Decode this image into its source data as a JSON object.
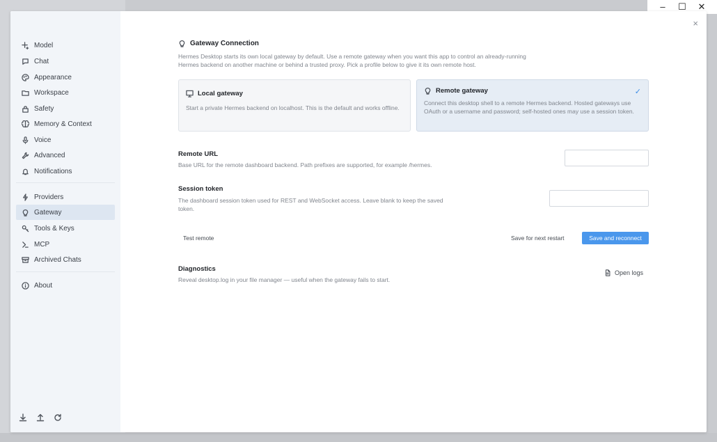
{
  "window": {
    "minimize": "–",
    "maximize": "☐",
    "close": "✕"
  },
  "dialog": {
    "close": "×"
  },
  "sidebar": {
    "items": [
      {
        "label": "Model",
        "icon": "sparkle-icon"
      },
      {
        "label": "Chat",
        "icon": "chat-bubble-icon"
      },
      {
        "label": "Appearance",
        "icon": "palette-icon"
      },
      {
        "label": "Workspace",
        "icon": "folder-icon"
      },
      {
        "label": "Safety",
        "icon": "lock-icon"
      },
      {
        "label": "Memory & Context",
        "icon": "brain-icon"
      },
      {
        "label": "Voice",
        "icon": "microphone-icon"
      },
      {
        "label": "Advanced",
        "icon": "wrench-icon"
      },
      {
        "label": "Notifications",
        "icon": "bell-icon"
      },
      {
        "label": "Providers",
        "icon": "plug-icon"
      },
      {
        "label": "Gateway",
        "icon": "lightbulb-icon"
      },
      {
        "label": "Tools & Keys",
        "icon": "key-icon"
      },
      {
        "label": "MCP",
        "icon": "server-icon"
      },
      {
        "label": "Archived Chats",
        "icon": "archive-icon"
      },
      {
        "label": "About",
        "icon": "info-icon"
      }
    ],
    "active": "Gateway",
    "footer_icons": [
      "download-icon",
      "upload-icon",
      "refresh-icon"
    ]
  },
  "main": {
    "title": "Gateway Connection",
    "description": "Hermes Desktop starts its own local gateway by default. Use a remote gateway when you want this app to control an already-running Hermes backend on another machine or behind a trusted proxy. Pick a profile below to give it its own remote host.",
    "local_card": {
      "title": "Local gateway",
      "description": "Start a private Hermes backend on localhost. This is the default and works offline."
    },
    "remote_card": {
      "title": "Remote gateway",
      "description": "Connect this desktop shell to a remote Hermes backend. Hosted gateways use OAuth or a username and password; self-hosted ones may use a session token.",
      "selected_mark": "✓"
    },
    "remote_url": {
      "label": "Remote URL",
      "description": "Base URL for the remote dashboard backend. Path prefixes are supported, for example /hermes.",
      "value": ""
    },
    "session_token": {
      "label": "Session token",
      "description": "The dashboard session token used for REST and WebSocket access. Leave blank to keep the saved token.",
      "value": ""
    },
    "actions": {
      "test": "Test remote",
      "save_next": "Save for next restart",
      "save_reconnect": "Save and reconnect"
    },
    "diagnostics": {
      "label": "Diagnostics",
      "description": "Reveal desktop.log in your file manager — useful when the gateway fails to start.",
      "open_logs": "Open logs"
    }
  },
  "colors": {
    "accent": "#4a97ec",
    "check": "#3d8ee6",
    "sidebar_bg": "#f2f5f9",
    "active_bg": "#dde6f1"
  }
}
